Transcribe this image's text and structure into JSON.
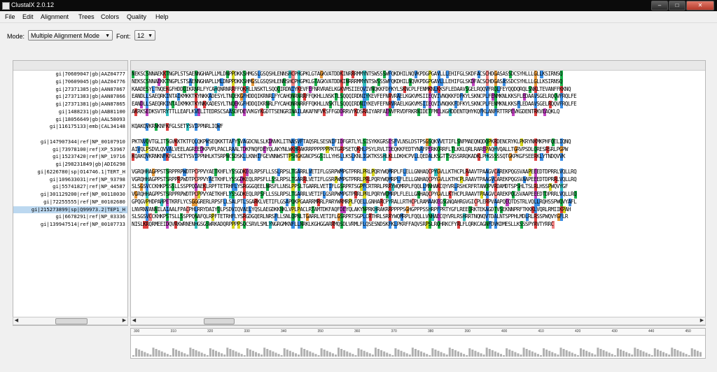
{
  "window": {
    "title": "ClustalX 2.0.12",
    "buttons": [
      "–",
      "□",
      "✕"
    ]
  },
  "menu": [
    "File",
    "Edit",
    "Alignment",
    "Trees",
    "Colors",
    "Quality",
    "Help"
  ],
  "toolbar": {
    "mode_label": "Mode:",
    "mode_value": "Multiple Alignment Mode",
    "font_label": "Font:",
    "font_value": "12"
  },
  "names": [
    "gi|70609047|gb|AAZ04777",
    "gi|70609045|gb|AAZ04776",
    "gi|27371385|gb|AAN87867",
    "gi|27371383|gb|AAN87866",
    "gi|27371381|gb|AAN87865",
    "gi|1488231|gb|AAB81100",
    "gi|18056649|gb|AAL58093",
    "gi|116175133|emb|CAL34148",
    "",
    "gi|147907344|ref|NP_00107910",
    "gi|73978100|ref|XP_53967",
    "gi|15237420|ref|NP_19716",
    "gi|298231849|gb|ADI6298",
    "gi|6226780|sp|O14746.1|TERT_H",
    "gi|109633031|ref|NP_93798",
    "gi|55741827|ref|NP_44587",
    "gi|301129200|ref|NP_00118030",
    "gi|72255555|ref|NP_00102680",
    "gi|215273899|sp|Q99973.2|TEP1_H",
    "gi|6678291|ref|NP_03336",
    "gi|139947514|ref|NP_00107733"
  ],
  "sequences": [
    "NEKSCSNNAEKKTNGPLSTSAENNGHAPLLMLDNPPDKKSHMGSLGSQSHLENNSHCPHGPKLGTAGKVATDDKINRRRMMYNTSWSSSWFQKDHILNQVKPDGPGAVLLLEHIFGLSKDFACSCHDGASASSDCSYHLLLGLLKSIRNSQ",
    "NEKSCSNNAEKKTNGPLSTSAENNGHAPLLMLDNPPDKKSHMGSLGSQSHLENNSHCPHGPKLGTAGKVATDDKINRRRMMYNTSWSSSWFQKDHILNQVKPDGPGAVLLLEHIFGLSKDFACSCHDGASASSDCSYHLLLGLLKSIRNSQ",
    "KAADESYLTNQEKGFHDDQIKRNRLFYCAHQNRNRRFFQKHLLNSKTLSQQQIRDNIYKEVFEFNRVRAELKGKVMSIIEQVIVNQKKFDFKYLSKNCPLFENMKNLKKSFLEDAAVSGELRQQVFRQLFEYQQDQRQLSNKLTEVANFFKKNQ",
    "EANDLLSAEQRKINTAIKMKKTKYNKKADESYLTNQEKGFHDDQIKRNRLFYCAHQNRNRRFFQKHLLNSKTLSQQQIRDNIYKEVFEFNRVRAELKGKVMSIIEQVIVNQKKFDFKYLSKNCPLFENMKNLKKSFLEDAAVSGELRQQVFRQLFE",
    "EANDLLSAEQRKINTAIKMKKTKYNKKADESYLTNQEKGFHDDQIKRNRLFYCAHQNRNRRFFQKHLLNSKTLSQQQIRDNIYKEVFEFNRVRAELKGKVMSIIEQVIVNQKKFDFKYLSKNCPLFENMKNLKKSFLEDAAVSGELRQQVFRQLFE",
    "AKRKSEDKSVTRYTTLLEAFLKVELITEDRSCSAASDFDEVVKGYKGDTTSENGRINAILAKAFNFVKSFFGDDRRVYKDSRAIYARFAENVFRVDFRKRNIDETFMELKGHDDENTQHYKQFKLANFRTTRPEVKGDENTRKVEAQKLQ",
    "",
    "KQAKQVKRNKNFKFGLSETYSVIPPNRLIQWF",
    "",
    "PKTNVQVTGLITSGVKKTKTFQLQKPWSEQKKTTAFYSVAGDCNLSLKDNVKLITNASVFTAQSRLSESNIFIDFGRTLYLSISYKKGRSESFVLNSLDSTPSGSQKVVETIFLSNFMAEQNQDQPKRDENCRYKLPKRYNKMKPHFQELIQNQ",
    "AIVQLPSDVLQVVALVEELAGREEDKPVPLPACLRAALTDKFNQFDEYQLAKYNLWKHRAKRRPPPPPPPKTGRPSETQKHLPSYLRVLTDEQKKFEDTYNAFPERKQRRFLTLKKLQRLRAREPAQHVQALLTGRVPSDLQRESRSRLPGPW",
    "KQAKQVKRNKNFKFGLSETYSVIPPNHLKTSRPNCSDSKLLKNHIFGEVNNWSTTPSHGKGNCPSGSILLYHSLLKSLKNLIGKTKSSHLKLLDKHCPVLLQEDALKSGTTSQSSRRQKADKLPHGSSSSQTGKPKGFSEERKLYTNDQVVK",
    "",
    "VGRQHHAGPPSTSRPPRPWDTPCPPVYAETKHFLYSSGDKEQLRPSFLLSSLRPSLTGARRLVETIFLGSRPWMPGTPRRLPRLPQRYWQMRPLFLELLGNHAQCPYGVLLKTHCPLRAAVTPAAGVCAREKPQGSVAAPEEEDTDPRRLVQLLRQ",
    "VGRQHHAGPPSTSRPPRPWDTPCPPVYAETKHFLYSSGDKEQLRPSFLLSSLRPSLTGARRLVETIFLGSRPWMPGTPRRLPRLPQRYWQMRPLFLELLGNHAQCPYGVLLKTHCPLRAAVTPAAGVCAREKPQGSVAAPEEEDTDPRRLVQLLRQ",
    "SLSGSVCCKHKPSSSLLSSPPQDAEKLRPFTETRHFLYSRGGGQEELNRSFLLNSLPPSLTGARRLVETIFLGSRPRTSGPFCRTRRLPRRYWQMRPLFQQLLMNHAKCQYVRLRSHCRFRTANQPVRDAMDTSPSHLTSLRLHSSPWQVYGF",
    "VGRQHHAGPPSTSRPPRPWDTPCPPVYAETKHFLYSSGDKEQLRPSFLLSSLRPSLTGARRLVETIFLGSRPWMPGTPRRLPRLPQRYWQMRPLFLELLGNHAQCPYGVLLKTHCPLRAAVTPAAGVCAREKPQGSVAAPEEEDTDPRRLVQLLRQ",
    "GPQGVPHDPAHPETKRFLYCSGGGRERLRPSFLLSALPTLSGARKLVETIFLGSAPQKPGAARRMRRLPARYWRMRPLFQELLGNHARCPYRALLRTHCPLRAMAAKEGSGNQAHRGVGICPLERPVAAPQEQTDSTRLVQLLRQHSSPWQVYAFL",
    "LNVRNVANNILAIAALFPACPHLRRYDAIYQLPSDVIQVAELYQSLAEGDKKNKLVPLPACLRTAMTDKFAQFDEYQLAKYNPRKHRAKRRPPPPSGHGPPPSSHRPFPRTYGFLREEQRKTEKAGDTVSEKNNPRFTKKKLVQRLRMIIKPAH",
    "SLSGSVCCKHKPSTSLLSSPPQNAFQLRPFTETRHFLYSRGDGQERLNRSFLLSNLQPNLTGARRLVETIFLGSRPRTSGPLCRTHRLSRRYWQMRPLFQQLLVNHAECQYVRLRSHRRTNQNQVTDALNTSPPHLMDLRLRSSPWQVYGFLR",
    "NISLKRQRMEEIDQVRKWRNENHGSGSWRKADQRPPPPSQCSRVLSMLYNGRGMKNFLLNRKLKGHGGARRMQSDLVRMLFLQSESNDSKFKLPKRFFAQVSRPSLRQHRKCFYRLFLQRKCAGNFDVKDMESLLKSSSPYRVTYRRC"
  ],
  "ruler_ticks": [
    "300",
    "310",
    "320",
    "330",
    "340",
    "350",
    "360",
    "370",
    "380",
    "390",
    "400",
    "410",
    "420",
    "430",
    "440",
    "450"
  ],
  "selected_row": 18,
  "colors": {
    "hydrophobic": "#3a8ee6",
    "polar": "#19b34a",
    "positive": "#e04040",
    "negative": "#c040c0",
    "glycine": "#e89a3a",
    "proline": "#d8d820",
    "cys": "#f08080",
    "aromatic": "#30c0c0"
  }
}
